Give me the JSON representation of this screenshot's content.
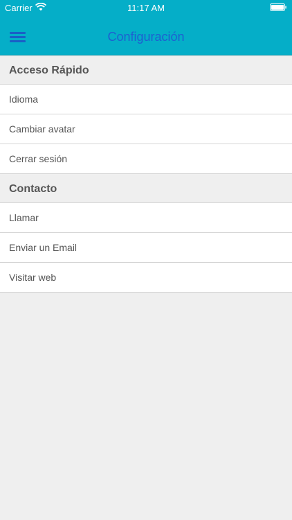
{
  "status_bar": {
    "carrier": "Carrier",
    "time": "11:17 AM",
    "wifi_icon": "wifi-icon",
    "battery_icon": "battery-icon"
  },
  "nav": {
    "title": "Configuración",
    "menu_icon": "hamburger-menu-icon",
    "background": "#05aec8",
    "title_color": "#1e5fd1"
  },
  "sections": [
    {
      "title": "Acceso Rápido",
      "items": [
        "Idioma",
        "Cambiar avatar",
        "Cerrar sesión"
      ]
    },
    {
      "title": "Contacto",
      "items": [
        "Llamar",
        "Enviar un Email",
        "Visitar web"
      ]
    }
  ]
}
